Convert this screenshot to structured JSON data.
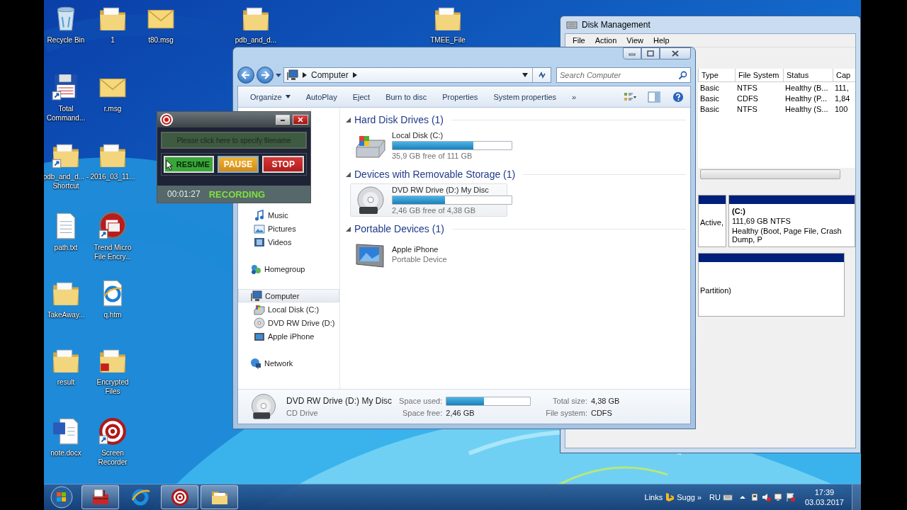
{
  "desktop": {
    "icons": [
      {
        "label": "Recycle Bin",
        "kind": "recycle",
        "shortcut": false
      },
      {
        "label": "1",
        "kind": "folder",
        "shortcut": false
      },
      {
        "label": "t80.msg",
        "kind": "mail",
        "shortcut": false
      },
      {
        "label": "pdb_and_d...",
        "kind": "folder",
        "shortcut": false
      },
      {
        "label": "TMEE_File",
        "kind": "folder",
        "shortcut": false
      },
      {
        "label": "Total Command...",
        "kind": "floppy",
        "shortcut": true
      },
      {
        "label": "r.msg",
        "kind": "mail",
        "shortcut": false
      },
      {
        "label": "pdb_and_d... - Shortcut",
        "kind": "folder",
        "shortcut": true
      },
      {
        "label": "2016_03_11...",
        "kind": "folder",
        "shortcut": false
      },
      {
        "label": "path.txt",
        "kind": "text",
        "shortcut": false
      },
      {
        "label": "Trend Micro File Encry...",
        "kind": "encryption",
        "shortcut": true
      },
      {
        "label": "TakeAway...",
        "kind": "folder",
        "shortcut": false
      },
      {
        "label": "q.htm",
        "kind": "web",
        "shortcut": false
      },
      {
        "label": "result",
        "kind": "folder",
        "shortcut": false
      },
      {
        "label": "Encrypted Files",
        "kind": "locked-folder",
        "shortcut": false
      },
      {
        "label": "note.docx",
        "kind": "word",
        "shortcut": false
      },
      {
        "label": "Screen Recorder",
        "kind": "target",
        "shortcut": true
      }
    ]
  },
  "disk_management": {
    "title": "Disk Management",
    "menu": [
      "File",
      "Action",
      "View",
      "Help"
    ],
    "columns": [
      "Type",
      "File System",
      "Status",
      "Cap"
    ],
    "rows": [
      [
        "Basic",
        "NTFS",
        "Healthy (B...",
        "111,"
      ],
      [
        "Basic",
        "CDFS",
        "Healthy (P...",
        "1,84"
      ],
      [
        "Basic",
        "NTFS",
        "Healthy (S...",
        "100"
      ]
    ],
    "disk_fragment": "Active,",
    "partition": {
      "name": "(C:)",
      "size": "111,69 GB NTFS",
      "status": "Healthy (Boot, Page File, Crash Dump, P"
    },
    "cd_fragment": "Partition)"
  },
  "explorer": {
    "address": "Computer",
    "search": {
      "placeholder": "Search Computer"
    },
    "toolbar": [
      {
        "label": "Organize",
        "dropdown": true
      },
      {
        "label": "AutoPlay",
        "dropdown": false
      },
      {
        "label": "Eject",
        "dropdown": false
      },
      {
        "label": "Burn to disc",
        "dropdown": false
      },
      {
        "label": "Properties",
        "dropdown": false
      },
      {
        "label": "System properties",
        "dropdown": false
      },
      {
        "label": "»",
        "dropdown": false
      }
    ],
    "sidebar": {
      "library_items": [
        {
          "label": "Music",
          "kind": "music",
          "selected": false
        },
        {
          "label": "Pictures",
          "kind": "pictures",
          "selected": false
        },
        {
          "label": "Videos",
          "kind": "videos",
          "selected": false
        }
      ],
      "nodes": [
        {
          "label": "Homegroup",
          "kind": "homegroup",
          "selected": false
        },
        {
          "label": "Computer",
          "kind": "computer",
          "selected": true,
          "children": [
            {
              "label": "Local Disk (C:)",
              "kind": "disk",
              "selected": false
            },
            {
              "label": "DVD RW Drive (D:)",
              "kind": "dvd",
              "selected": false
            },
            {
              "label": "Apple iPhone",
              "kind": "device",
              "selected": false
            }
          ]
        },
        {
          "label": "Network",
          "kind": "network",
          "selected": false
        }
      ]
    },
    "groups": [
      {
        "title": "Hard Disk Drives (1)",
        "expanded": true,
        "items": [
          {
            "name": "Local Disk (C:)",
            "kind": "disk",
            "level": 0.68,
            "detail": "35,9 GB free of 111 GB",
            "selected": false
          }
        ]
      },
      {
        "title": "Devices with Removable Storage (1)",
        "expanded": true,
        "items": [
          {
            "name": "DVD RW Drive (D:) My Disc",
            "kind": "dvd",
            "level": 0.44,
            "detail": "2,46 GB free of 4,38 GB",
            "selected": true
          }
        ]
      },
      {
        "title": "Portable Devices (1)",
        "expanded": true,
        "items": [
          {
            "name": "Apple iPhone",
            "kind": "device",
            "detail": "Portable Device",
            "selected": false
          }
        ]
      }
    ],
    "details": {
      "name": "DVD RW Drive (D:) My Disc",
      "type": "CD Drive",
      "fields": [
        {
          "label": "Space used:",
          "kind": "bar",
          "level": 0.45
        },
        {
          "label": "Total size:",
          "kind": "text",
          "value": "4,38 GB"
        },
        {
          "label": "Space free:",
          "kind": "text",
          "value": "2,46 GB"
        },
        {
          "label": "File system:",
          "kind": "text",
          "value": "CDFS"
        }
      ]
    }
  },
  "recorder": {
    "filename_prompt": "Please click here to specify filename",
    "buttons": [
      {
        "label": "RESUME",
        "kind": "resume"
      },
      {
        "label": "PAUSE",
        "kind": "pause"
      },
      {
        "label": "STOP",
        "kind": "stop"
      }
    ],
    "time": "00:01:27",
    "status": "RECORDING"
  },
  "taskbar": {
    "apps": [
      {
        "kind": "toolbox",
        "running": true
      },
      {
        "kind": "browser",
        "running": false
      },
      {
        "kind": "target",
        "running": true
      },
      {
        "kind": "folder",
        "running": true
      }
    ],
    "links": "Links",
    "search_label": "Sugg",
    "more": "»",
    "language": "RU",
    "time": "17:39",
    "date": "03.03.2017"
  }
}
